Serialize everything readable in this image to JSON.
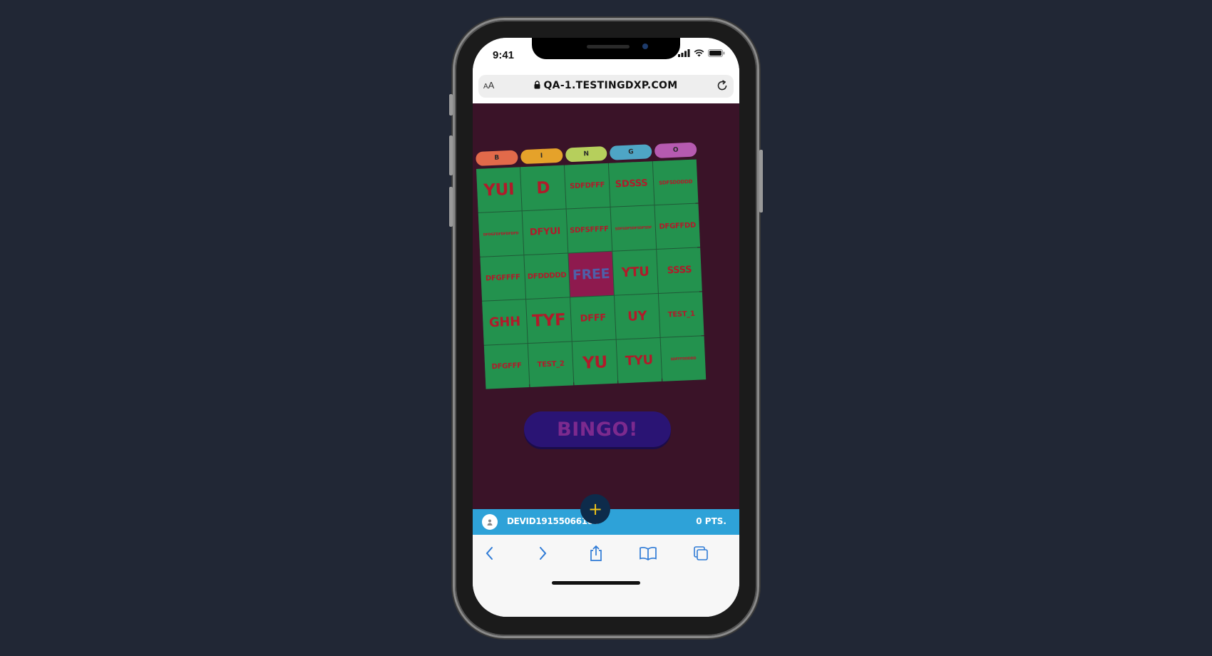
{
  "status_bar": {
    "time": "9:41"
  },
  "browser": {
    "text_size_label": "AA",
    "url": "QA-1.TESTINGDXP.COM"
  },
  "game": {
    "header_letters": [
      {
        "letter": "B",
        "color": "#e26a4a"
      },
      {
        "letter": "I",
        "color": "#e5a22a"
      },
      {
        "letter": "N",
        "color": "#b6cf5c"
      },
      {
        "letter": "G",
        "color": "#4ea5c5"
      },
      {
        "letter": "O",
        "color": "#b65ab0"
      }
    ],
    "cells": [
      {
        "text": "YUI",
        "size": "xl"
      },
      {
        "text": "D",
        "size": "xl"
      },
      {
        "text": "SDFDFFF",
        "size": "s"
      },
      {
        "text": "SDSSS",
        "size": "m"
      },
      {
        "text": "SDFSDDDDD",
        "size": "xs"
      },
      {
        "text": "DFDGFDFDFDFDFD",
        "size": "xxs"
      },
      {
        "text": "DFYUI",
        "size": "m"
      },
      {
        "text": "SDFSFFFF",
        "size": "s"
      },
      {
        "text": "SDFSDFSDFSDFSDF",
        "size": "xxs"
      },
      {
        "text": "DFGFFDD",
        "size": "s"
      },
      {
        "text": "DFGFFFF",
        "size": "s"
      },
      {
        "text": "DFDDDDD",
        "size": "s"
      },
      {
        "text": "FREE",
        "size": "free"
      },
      {
        "text": "YTU",
        "size": "l"
      },
      {
        "text": "SSSS",
        "size": "m"
      },
      {
        "text": "GHH",
        "size": "l"
      },
      {
        "text": "TYF",
        "size": "xl"
      },
      {
        "text": "DFFF",
        "size": "m"
      },
      {
        "text": "UY",
        "size": "l"
      },
      {
        "text": "TEST_1",
        "size": "s"
      },
      {
        "text": "DFGFFF",
        "size": "s"
      },
      {
        "text": "TEST_2",
        "size": "s"
      },
      {
        "text": "YU",
        "size": "xl"
      },
      {
        "text": "TYU",
        "size": "l"
      },
      {
        "text": "SDFFFDDDDD",
        "size": "xxs"
      }
    ],
    "bingo_button": "BINGO!",
    "add_button": "+"
  },
  "user_bar": {
    "username": "DEVID19155066188",
    "points": "0 PTS."
  },
  "colors": {
    "game_bg": "#3a1328",
    "cell_bg": "#23924e",
    "cell_text": "#b01b2a",
    "user_bar": "#2ea2d8",
    "bingo_button": "#2a1474",
    "ios_blue": "#2f7bd6"
  },
  "toolbar": {
    "icons": [
      "back-icon",
      "forward-icon",
      "share-icon",
      "bookmarks-icon",
      "tabs-icon"
    ]
  }
}
